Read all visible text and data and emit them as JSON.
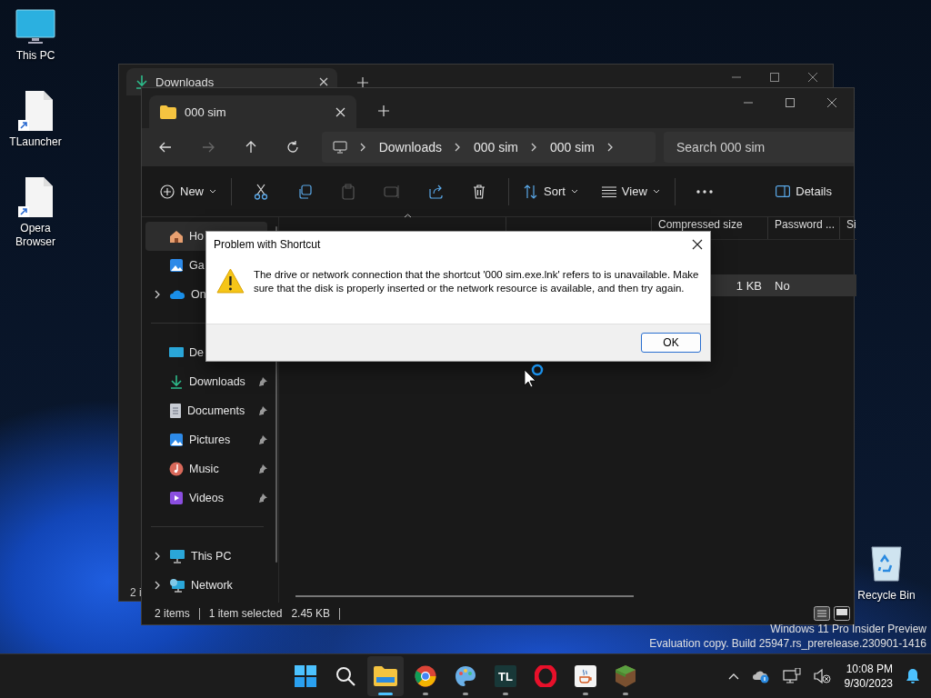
{
  "desktop_icons": [
    {
      "label": "This PC",
      "kind": "computer"
    },
    {
      "label": "TLauncher",
      "kind": "shortcut"
    },
    {
      "label": "Opera Browser",
      "kind": "shortcut"
    }
  ],
  "recycle_bin": {
    "label": "Recycle Bin"
  },
  "back_window": {
    "tab_title": "Downloads",
    "status": "2 i"
  },
  "explorer": {
    "tab_title": "000 sim",
    "breadcrumb": [
      "Downloads",
      "000 sim",
      "000 sim"
    ],
    "search": {
      "placeholder": "Search 000 sim"
    },
    "toolbar": {
      "new": "New",
      "sort": "Sort",
      "view": "View",
      "details": "Details"
    },
    "sidebar": [
      {
        "items": [
          {
            "label": "Ho",
            "kind": "home",
            "selected": true,
            "has_children": false
          },
          {
            "label": "Ga",
            "kind": "gallery",
            "selected": false,
            "has_children": false
          },
          {
            "label": "On",
            "kind": "cloud",
            "selected": false,
            "has_children": true
          }
        ]
      },
      {
        "items": [
          {
            "label": "De",
            "kind": "desktop",
            "selected": false,
            "has_children": false
          },
          {
            "label": "Downloads",
            "kind": "downloads",
            "selected": false,
            "pinned": true,
            "has_children": false
          },
          {
            "label": "Documents",
            "kind": "documents",
            "selected": false,
            "pinned": true,
            "has_children": false
          },
          {
            "label": "Pictures",
            "kind": "pictures",
            "selected": false,
            "pinned": true,
            "has_children": false
          },
          {
            "label": "Music",
            "kind": "music",
            "selected": false,
            "pinned": true,
            "has_children": false
          },
          {
            "label": "Videos",
            "kind": "videos",
            "selected": false,
            "pinned": true,
            "has_children": false
          }
        ]
      },
      {
        "items": [
          {
            "label": "This PC",
            "kind": "pc",
            "selected": false,
            "pinned": false,
            "has_children": true
          },
          {
            "label": "Network",
            "kind": "network",
            "selected": false,
            "pinned": false,
            "has_children": true
          }
        ]
      }
    ],
    "columns": [
      "Compressed size",
      "Password ...",
      "Si"
    ],
    "rows": [
      {
        "selected": true,
        "cells": [
          "1 KB",
          "No"
        ]
      }
    ],
    "status_bar": {
      "count": "2 items",
      "selection": "1 item selected",
      "size": "2.45 KB"
    }
  },
  "dialog": {
    "title": "Problem with Shortcut",
    "message": "The drive or network connection that the shortcut '000 sim.exe.lnk' refers to is unavailable. Make sure that the disk is properly inserted or the network resource is available, and then try again.",
    "button": "OK"
  },
  "os_watermark": [
    "Windows 11 Pro Insider Preview",
    "Evaluation copy. Build 25947.rs_prerelease.230901-1416"
  ],
  "taskbar": {
    "apps": [
      {
        "kind": "start",
        "running": false,
        "selected": false
      },
      {
        "kind": "search",
        "running": false,
        "selected": false
      },
      {
        "kind": "explorer",
        "running": true,
        "selected": true
      },
      {
        "kind": "chrome",
        "running": true,
        "selected": false
      },
      {
        "kind": "paint",
        "running": true,
        "selected": false
      },
      {
        "kind": "tlauncher",
        "label": "TL",
        "running": true,
        "selected": false
      },
      {
        "kind": "opera",
        "running": false,
        "selected": false
      },
      {
        "kind": "java",
        "running": true,
        "selected": false
      },
      {
        "kind": "minecraft",
        "running": true,
        "selected": false
      }
    ],
    "time": "10:08 PM",
    "date": "9/30/2023"
  }
}
